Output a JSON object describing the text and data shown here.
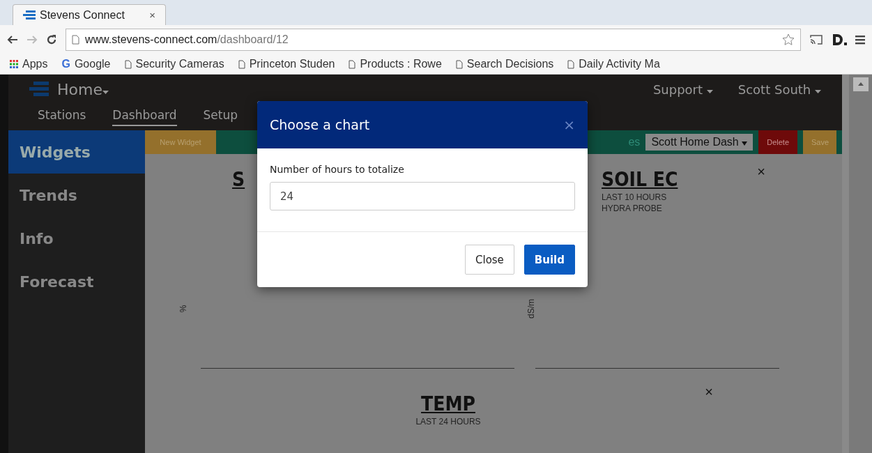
{
  "browser": {
    "tab_title": "Stevens Connect",
    "tab_close": "×",
    "url_host": "www.stevens-connect.com",
    "url_path": "/dashboard/12",
    "bookmarks": [
      {
        "label": "Apps",
        "kind": "apps"
      },
      {
        "label": "Google",
        "kind": "google",
        "icon": "G"
      },
      {
        "label": "Security Cameras",
        "kind": "page"
      },
      {
        "label": "Princeton Studen",
        "kind": "page"
      },
      {
        "label": "Products : Rowe",
        "kind": "page"
      },
      {
        "label": "Search Decisions",
        "kind": "page"
      },
      {
        "label": "Daily Activity Ma",
        "kind": "page"
      }
    ]
  },
  "header": {
    "brand": "Home",
    "menus": [
      "Support",
      "Scott South"
    ],
    "nav": [
      {
        "label": "Stations",
        "selected": false
      },
      {
        "label": "Dashboard",
        "selected": true
      },
      {
        "label": "Setup",
        "selected": false
      }
    ]
  },
  "sidebar": {
    "items": [
      {
        "label": "Widgets",
        "selected": true
      },
      {
        "label": "Trends",
        "selected": false
      },
      {
        "label": "Info",
        "selected": false
      },
      {
        "label": "Forecast",
        "selected": false
      }
    ]
  },
  "toolbar": {
    "new_widget": "New Widget",
    "dashboards_label": "es",
    "dashboard_select": "Scott Home Dash",
    "delete": "Delete",
    "save": "Save"
  },
  "widgets": [
    {
      "title": "S",
      "y_label": "%"
    },
    {
      "title": "SOIL EC",
      "subtitles": [
        "LAST 10 HOURS",
        "HYDRA PROBE"
      ],
      "y_label": "dS/m",
      "close": "×"
    },
    {
      "title": "TEMP",
      "subtitles": [
        "LAST 24 HOURS"
      ],
      "close": "×"
    }
  ],
  "modal": {
    "title": "Choose a chart",
    "close": "×",
    "field_label": "Number of hours to totalize",
    "field_value": "24",
    "buttons": [
      {
        "label": "Close",
        "kind": "default"
      },
      {
        "label": "Build",
        "kind": "primary"
      }
    ]
  }
}
